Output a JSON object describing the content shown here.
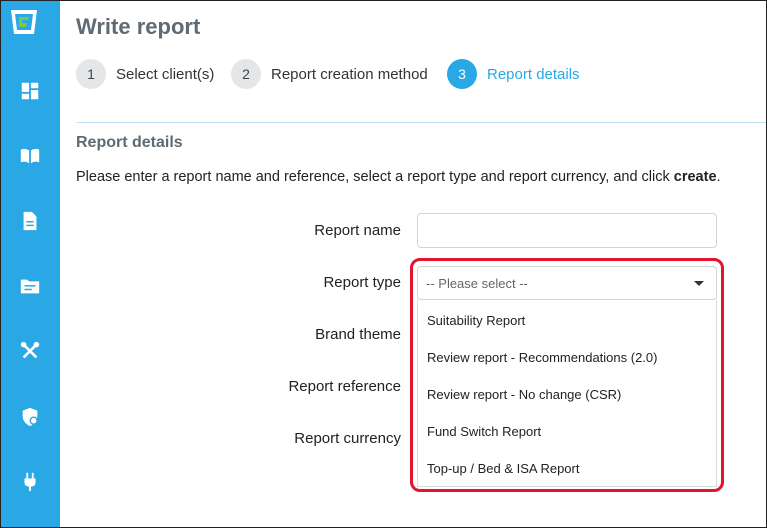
{
  "page": {
    "title": "Write report"
  },
  "steps": [
    {
      "number": "1",
      "label": "Select client(s)",
      "active": false
    },
    {
      "number": "2",
      "label": "Report creation method",
      "active": false
    },
    {
      "number": "3",
      "label": "Report details",
      "active": true
    }
  ],
  "section": {
    "title": "Report details",
    "instructions_prefix": "Please enter a report name and reference, select a report type and report currency, and click ",
    "instructions_emphasis": "create",
    "instructions_suffix": "."
  },
  "form": {
    "report_name_label": "Report name",
    "report_name_value": "",
    "report_type_label": "Report type",
    "report_type_selected": "-- Please select --",
    "brand_theme_label": "Brand theme",
    "report_reference_label": "Report reference",
    "report_currency_label": "Report currency"
  },
  "dropdown": {
    "options": [
      "Suitability Report",
      "Review report - Recommendations (2.0)",
      "Review report - No change (CSR)",
      "Fund Switch Report",
      "Top-up / Bed & ISA Report"
    ]
  },
  "sidebar": {
    "icons": [
      "logo-icon",
      "dashboard-icon",
      "book-icon",
      "document-icon",
      "folder-icon",
      "tools-icon",
      "shield-icon",
      "plug-icon"
    ]
  },
  "colors": {
    "sidebar": "#2aa8e6",
    "accent": "#2aa8e6",
    "highlight": "#e3142d"
  }
}
